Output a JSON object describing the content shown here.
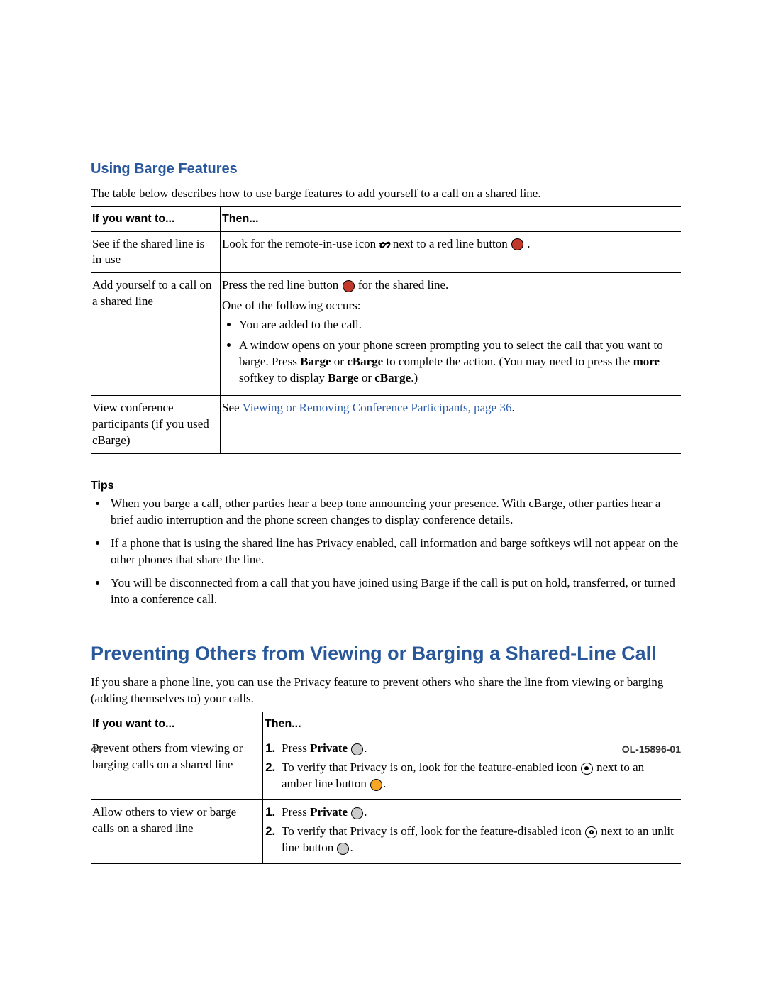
{
  "section1": {
    "heading": "Using Barge Features",
    "intro": "The table below describes how to use barge features to add yourself to a call on a shared line.",
    "th_if": "If you want to...",
    "th_then": "Then...",
    "r1c1": "See if the shared line is in use",
    "r1c2_a": "Look for the remote-in-use icon ",
    "r1c2_b": " next to a red line button ",
    "r1c2_c": ".",
    "r2c1": "Add yourself to a call on a shared line",
    "r2_l1a": "Press the red line button ",
    "r2_l1b": " for the shared line.",
    "r2_l2": "One of the following occurs:",
    "r2_b1": "You are added to the call.",
    "r2_b2a": "A window opens on your phone screen prompting you to select the call that you want to barge. Press ",
    "r2_b2_barge": "Barge",
    "r2_b2_or1": " or ",
    "r2_b2_cbarge": "cBarge",
    "r2_b2b": " to complete the action. (You may need to press the ",
    "r2_b2_more": "more",
    "r2_b2c": " softkey to display ",
    "r2_b2d": ".)",
    "r3c1": "View conference participants (if you used cBarge)",
    "r3_see": "See ",
    "r3_link": "Viewing or Removing Conference Participants, page 36",
    "r3_dot": "."
  },
  "tips": {
    "heading": "Tips",
    "t1": "When you barge a call, other parties hear a beep tone announcing your presence. With cBarge, other parties hear a brief audio interruption and the phone screen changes to display conference details.",
    "t2": "If a phone that is using the shared line has Privacy enabled, call information and barge softkeys will not appear on the other phones that share the line.",
    "t3": "You will be disconnected from a call that you have joined using Barge if the call is put on hold, transferred, or turned into a conference call."
  },
  "section2": {
    "heading": "Preventing Others from Viewing or Barging a Shared-Line Call",
    "intro": "If you share a phone line, you can use the Privacy feature to prevent others who share the line from viewing or barging (adding themselves to) your calls.",
    "th_if": "If you want to...",
    "th_then": "Then...",
    "r1c1": "Prevent others from viewing or barging calls on a shared line",
    "r1_s1a": "Press ",
    "private": "Private",
    "r1_s1b": " ",
    "r1_s1c": ".",
    "r1_s2a": "To verify that Privacy is on, look for the feature-enabled icon ",
    "r1_s2b": " next to an amber line button ",
    "r1_s2c": ".",
    "r2c1": "Allow others to view or barge calls on a shared line",
    "r2_s2a": "To verify that Privacy is off, look for the feature-disabled icon ",
    "r2_s2b": " next to an unlit line button ",
    "r2_s2c": "."
  },
  "footer": {
    "page": "44",
    "doc": "OL-15896-01"
  }
}
